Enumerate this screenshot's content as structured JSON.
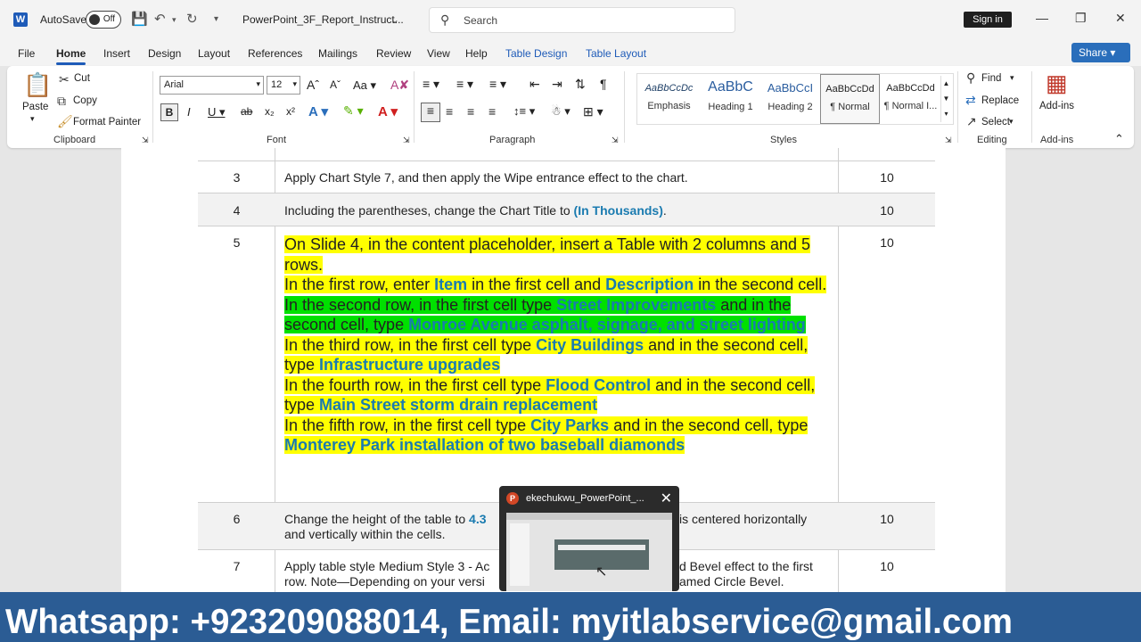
{
  "titlebar": {
    "autosave_label": "AutoSave",
    "autosave_state": "Off",
    "doc_title": "PowerPoint_3F_Report_Instruct...",
    "search_placeholder": "Search",
    "signin": "Sign in"
  },
  "menu": {
    "tabs": [
      "File",
      "Home",
      "Insert",
      "Design",
      "Layout",
      "References",
      "Mailings",
      "Review",
      "View",
      "Help",
      "Table Design",
      "Table Layout"
    ],
    "active": "Home",
    "share": "Share"
  },
  "ribbon": {
    "clipboard": {
      "paste": "Paste",
      "cut": "Cut",
      "copy": "Copy",
      "format_painter": "Format Painter",
      "label": "Clipboard"
    },
    "font": {
      "name": "Arial",
      "size": "12",
      "label": "Font"
    },
    "paragraph": {
      "label": "Paragraph"
    },
    "styles": {
      "label": "Styles",
      "items": [
        {
          "preview": "AaBbCcDc",
          "name": "Emphasis"
        },
        {
          "preview": "AaBbC",
          "name": "Heading 1"
        },
        {
          "preview": "AaBbCcI",
          "name": "Heading 2"
        },
        {
          "preview": "AaBbCcDd",
          "name": "¶ Normal"
        },
        {
          "preview": "AaBbCcDd",
          "name": "¶ Normal I..."
        }
      ]
    },
    "editing": {
      "find": "Find",
      "replace": "Replace",
      "select": "Select",
      "label": "Editing"
    },
    "addins": {
      "name": "Add-ins",
      "label": "Add-ins"
    }
  },
  "doc": {
    "rows": [
      {
        "num": "3",
        "text": "Apply Chart Style 7, and then apply the Wipe entrance effect to the chart.",
        "points": "10"
      },
      {
        "num": "4",
        "text_pre": "Including the parentheses, change the Chart Title to ",
        "text_bold": "(In Thousands)",
        "text_post": ".",
        "points": "10"
      },
      {
        "num": "5",
        "points": "10",
        "line1": "On Slide 4, in the content placeholder, insert a Table with 2 columns and 5 rows.",
        "line2_pre": "In the first row, enter ",
        "line2_b1": "Item",
        "line2_mid": " in the first cell and ",
        "line2_b2": "Description",
        "line2_post": " in the second cell.",
        "line3_pre": "In the second row, in the first cell type ",
        "line3_b1": "Street Improvements",
        "line3_mid": " and in the second cell, type ",
        "line3_b2": "Monroe Avenue asphalt, signage, and street lighting",
        "line4_pre": "In the third row, in the first cell type ",
        "line4_b1": "City Buildings",
        "line4_mid": " and in the second cell, type ",
        "line4_b2": "Infrastructure upgrades",
        "line5_pre": "In the fourth row, in the first cell type ",
        "line5_b1": "Flood Control",
        "line5_mid": " and in the second cell, type ",
        "line5_b2": "Main Street storm drain replacement",
        "line6_pre": "In the fifth row, in the first cell type ",
        "line6_b1": "City Parks",
        "line6_mid": " and in the second cell, type ",
        "line6_b2": "Monterey Park installation of two baseball diamonds"
      },
      {
        "num": "6",
        "text_a": "Change the height of the table to ",
        "text_b": "4.3",
        "text_c": "is centered horizontally",
        "text_d": "and vertically within the cells.",
        "points": "10"
      },
      {
        "num": "7",
        "text_a": "Apply table style Medium Style 3 - Ac",
        "text_b": "d Bevel effect to the first",
        "text_c": "row. Note—Depending on your versi",
        "text_d": "amed Circle Bevel.",
        "points": "10"
      }
    ]
  },
  "popup": {
    "title": "ekechukwu_PowerPoint_..."
  },
  "watermark": "Whatsapp: +923209088014, Email: myitlabservice@gmail.com",
  "colors": {
    "accent": "#1e5bb8",
    "highlight_yellow": "#ffff00",
    "highlight_green": "#00e000",
    "answer_blue": "#1a7bb0"
  }
}
